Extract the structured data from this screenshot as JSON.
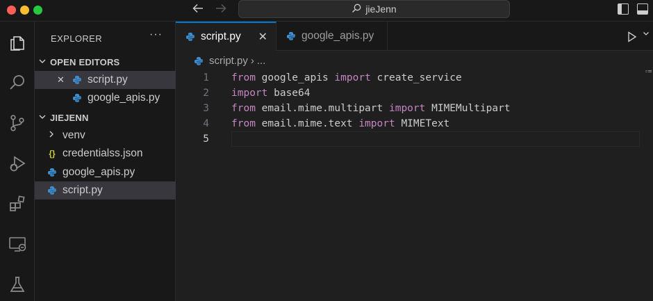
{
  "titlebar": {
    "search_text": "jieJenn",
    "back_icon": "arrow-left-icon",
    "forward_icon": "arrow-right-icon"
  },
  "activitybar": {
    "items": [
      "explorer-icon",
      "search-icon",
      "source-control-icon",
      "run-debug-icon",
      "extensions-icon",
      "remote-explorer-icon",
      "testing-icon"
    ]
  },
  "sidebar": {
    "title": "EXPLORER",
    "more": "···",
    "open_editors": {
      "label": "OPEN EDITORS",
      "items": [
        {
          "name": "script.py",
          "close": "✕"
        },
        {
          "name": "google_apis.py"
        }
      ]
    },
    "folder": {
      "label": "JIEJENN",
      "items": [
        {
          "name": "venv"
        },
        {
          "name": "credentialss.json"
        },
        {
          "name": "google_apis.py"
        },
        {
          "name": "script.py"
        }
      ]
    }
  },
  "editor": {
    "tabs": [
      {
        "label": "script.py",
        "close": "✕"
      },
      {
        "label": "google_apis.py"
      }
    ],
    "breadcrumb": {
      "file": "script.py",
      "sep": "›",
      "rest": "..."
    },
    "lines": [
      {
        "num": "1",
        "parts": [
          [
            "kw",
            "from"
          ],
          [
            "t",
            " google_apis "
          ],
          [
            "kw",
            "import"
          ],
          [
            "t",
            " create_service"
          ]
        ]
      },
      {
        "num": "2",
        "parts": [
          [
            "kw",
            "import"
          ],
          [
            "t",
            " base64"
          ]
        ]
      },
      {
        "num": "3",
        "parts": [
          [
            "kw",
            "from"
          ],
          [
            "t",
            " email.mime.multipart "
          ],
          [
            "kw",
            "import"
          ],
          [
            "t",
            " MIMEMultipart"
          ]
        ]
      },
      {
        "num": "4",
        "parts": [
          [
            "kw",
            "from"
          ],
          [
            "t",
            " email.mime.text "
          ],
          [
            "kw",
            "import"
          ],
          [
            "t",
            " MIMEText"
          ]
        ]
      },
      {
        "num": "5",
        "parts": []
      }
    ]
  },
  "colors": {
    "accent": "#0078d4",
    "keyword": "#c586c0",
    "python_blue": "#3776ab",
    "python_yellow": "#ffd43b"
  }
}
